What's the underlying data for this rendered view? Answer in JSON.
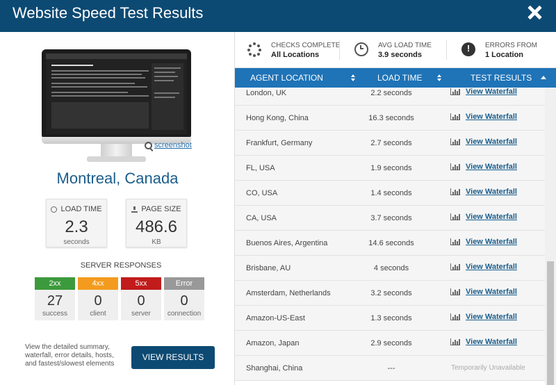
{
  "header": {
    "title": "Website Speed Test Results"
  },
  "location": {
    "city": "Montreal, Canada",
    "screenshot_link": "screenshot"
  },
  "metrics": {
    "load_time": {
      "label": "LOAD TIME",
      "value": "2.3",
      "unit": "seconds"
    },
    "page_size": {
      "label": "PAGE SIZE",
      "value": "486.6",
      "unit": "KB"
    }
  },
  "server_responses": {
    "title": "SERVER RESPONSES",
    "items": [
      {
        "code": "2xx",
        "count": "27",
        "label": "success",
        "color": "#3c9a3c"
      },
      {
        "code": "4xx",
        "count": "0",
        "label": "client",
        "color": "#f39b1e"
      },
      {
        "code": "5xx",
        "count": "0",
        "label": "server",
        "color": "#c11b1b"
      },
      {
        "code": "Error",
        "count": "0",
        "label": "connection",
        "color": "#999999"
      }
    ]
  },
  "summary_text": "View the detailed summary, waterfall, error details, hosts, and fastest/slowest elements",
  "view_results_button": "VIEW RESULTS",
  "stats": {
    "checks": {
      "label": "CHECKS COMPLETE",
      "value": "All Locations"
    },
    "avg": {
      "label": "AVG LOAD TIME",
      "value": "3.9 seconds"
    },
    "errors": {
      "label": "ERRORS FROM",
      "value": "1 Location"
    }
  },
  "table": {
    "columns": [
      "AGENT LOCATION",
      "LOAD TIME",
      "TEST RESULTS"
    ],
    "rows": [
      {
        "location": "London, UK",
        "load_time": "2.2 seconds",
        "result": "View Waterfall"
      },
      {
        "location": "Hong Kong, China",
        "load_time": "16.3 seconds",
        "result": "View Waterfall"
      },
      {
        "location": "Frankfurt, Germany",
        "load_time": "2.7 seconds",
        "result": "View Waterfall"
      },
      {
        "location": "FL, USA",
        "load_time": "1.9 seconds",
        "result": "View Waterfall"
      },
      {
        "location": "CO, USA",
        "load_time": "1.4 seconds",
        "result": "View Waterfall"
      },
      {
        "location": "CA, USA",
        "load_time": "3.7 seconds",
        "result": "View Waterfall"
      },
      {
        "location": "Buenos Aires, Argentina",
        "load_time": "14.6 seconds",
        "result": "View Waterfall"
      },
      {
        "location": "Brisbane, AU",
        "load_time": "4 seconds",
        "result": "View Waterfall"
      },
      {
        "location": "Amsterdam, Netherlands",
        "load_time": "3.2 seconds",
        "result": "View Waterfall"
      },
      {
        "location": "Amazon-US-East",
        "load_time": "1.3 seconds",
        "result": "View Waterfall"
      },
      {
        "location": "Amazon, Japan",
        "load_time": "2.9 seconds",
        "result": "View Waterfall"
      },
      {
        "location": "Shanghai, China",
        "load_time": "---",
        "result": "Temporarily Unavailable"
      }
    ]
  },
  "icons": {
    "close": "close-icon",
    "screenshot": "magnifier-icon",
    "checks": "spinner-icon",
    "avg": "clock-icon",
    "errors": "alert-icon",
    "waterfall": "bar-chart-icon"
  }
}
